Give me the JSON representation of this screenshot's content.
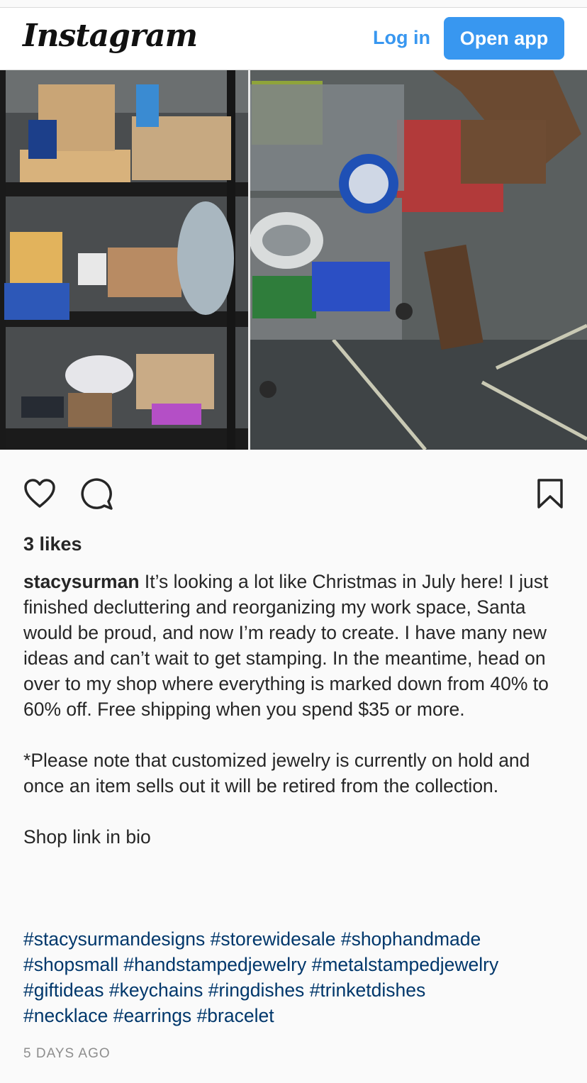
{
  "header": {
    "logo": "Instagram",
    "login_label": "Log in",
    "open_app_label": "Open app"
  },
  "colors": {
    "accent": "#3897f0",
    "hashtag": "#00376b",
    "muted": "#8e8e8e"
  },
  "actions": {
    "like_icon": "heart-icon",
    "comment_icon": "comment-icon",
    "save_icon": "bookmark-icon"
  },
  "post": {
    "likes": "3 likes",
    "username": "stacysurman",
    "caption": " It’s looking a lot like Christmas in July here! I just finished decluttering and reorganizing my work space, Santa would be proud, and now I’m ready to create. I have many new ideas and can’t wait to get stamping. In the meantime, head on over to my shop where everything is marked down from 40% to 60% off. Free shipping when you spend $35 or more.\n\n*Please note that customized jewelry is currently on hold and once an item sells out it will be retired from the collection.\n\nShop link in bio",
    "hashtags": [
      "#stacysurmandesigns",
      "#storewidesale",
      "#shophandmade",
      "#shopsmall",
      "#handstampedjewelry",
      "#metalstampedjewelry",
      "#giftideas",
      "#keychains",
      "#ringdishes",
      "#trinketdishes",
      "#necklace",
      "#earrings",
      "#bracelet"
    ],
    "timestamp": "5 DAYS AGO"
  }
}
